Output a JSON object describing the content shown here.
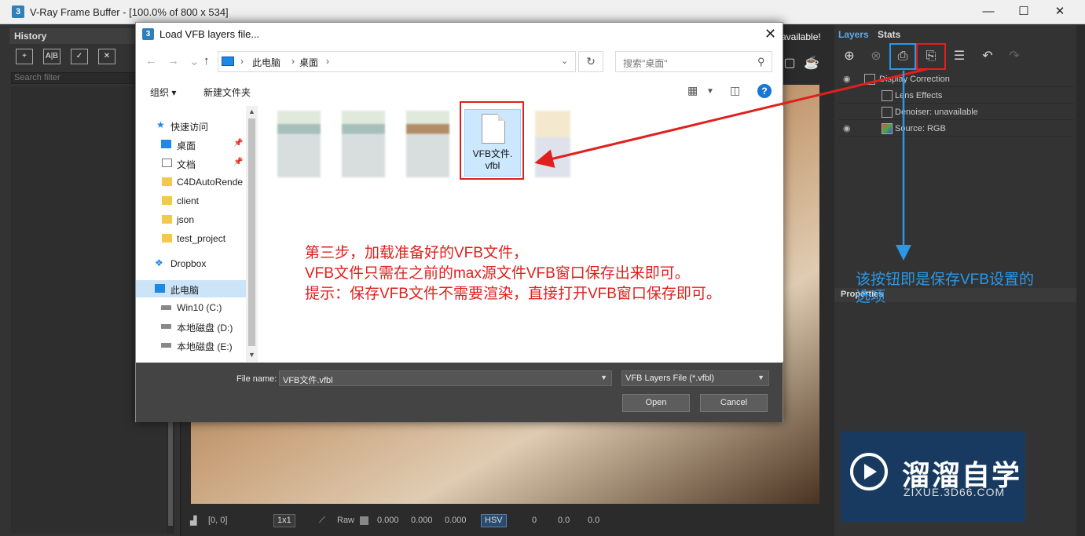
{
  "vfb": {
    "title": "V-Ray Frame Buffer - [100.0% of 800 x 534]",
    "app_icon": "3",
    "history_label": "History",
    "history_tools": [
      "+",
      "A|B",
      "✓",
      "✕"
    ],
    "search_filter_placeholder": "Search filter",
    "top_text": "available!",
    "layers_tab": "Layers",
    "stats_tab": "Stats",
    "layers": [
      {
        "label": "Display Correction",
        "eye": true
      },
      {
        "label": "Lens Effects",
        "eye": false
      },
      {
        "label": "Denoiser: unavailable",
        "eye": false
      },
      {
        "label": "Source: RGB",
        "eye": true
      }
    ],
    "properties_label": "Properties",
    "status": {
      "coords": "[0, 0]",
      "zoom": "1x1",
      "raw": "Raw",
      "v1": "0.000",
      "v2": "0.000",
      "v3": "0.000",
      "mode": "HSV",
      "h": "0",
      "s": "0.0",
      "v": "0.0"
    }
  },
  "dialog": {
    "title": "Load VFB layers file...",
    "icon": "3",
    "breadcrumb": [
      "此电脑",
      "桌面"
    ],
    "search_placeholder": "搜索\"桌面\"",
    "organize": "组织 ▾",
    "new_folder": "新建文件夹",
    "nav_items": [
      {
        "label": "快速访问",
        "icon": "star-icon",
        "pinned": false
      },
      {
        "label": "桌面",
        "icon": "desktop-icon",
        "pinned": true
      },
      {
        "label": "文档",
        "icon": "document-icon",
        "pinned": true
      },
      {
        "label": "C4DAutoRende",
        "icon": "folder-icon",
        "pinned": false
      },
      {
        "label": "client",
        "icon": "folder-icon",
        "pinned": false
      },
      {
        "label": "json",
        "icon": "folder-icon",
        "pinned": false
      },
      {
        "label": "test_project",
        "icon": "folder-icon",
        "pinned": false
      },
      {
        "label": "Dropbox",
        "icon": "dropbox-icon",
        "pinned": false
      },
      {
        "label": "此电脑",
        "icon": "pc-icon",
        "pinned": false
      },
      {
        "label": "Win10 (C:)",
        "icon": "drive-icon",
        "pinned": false
      },
      {
        "label": "本地磁盘 (D:)",
        "icon": "drive-icon",
        "pinned": false
      },
      {
        "label": "本地磁盘 (E:)",
        "icon": "drive-icon",
        "pinned": false
      }
    ],
    "selected_file": "VFB文件.vfbl",
    "selected_file_line1": "VFB文件.",
    "selected_file_line2": "vfbl",
    "file_name_label": "File name:",
    "file_name_value": "VFB文件.vfbl",
    "file_type_value": "VFB Layers File (*.vfbl)",
    "open_button": "Open",
    "cancel_button": "Cancel"
  },
  "annotations": {
    "red_note": [
      "第三步，加载准备好的VFB文件，",
      "VFB文件只需在之前的max源文件VFB窗口保存出来即可。",
      "提示：保存VFB文件不需要渲染，直接打开VFB窗口保存即可。"
    ],
    "blue_note": "该按钮即是保存VFB设置的选项"
  },
  "watermark": {
    "title": "溜溜自学",
    "url": "ZIXUE.3D66.COM"
  },
  "colors": {
    "accent_red": "#e0201c",
    "accent_blue": "#2a98e8",
    "selection_blue": "#cce8ff"
  }
}
